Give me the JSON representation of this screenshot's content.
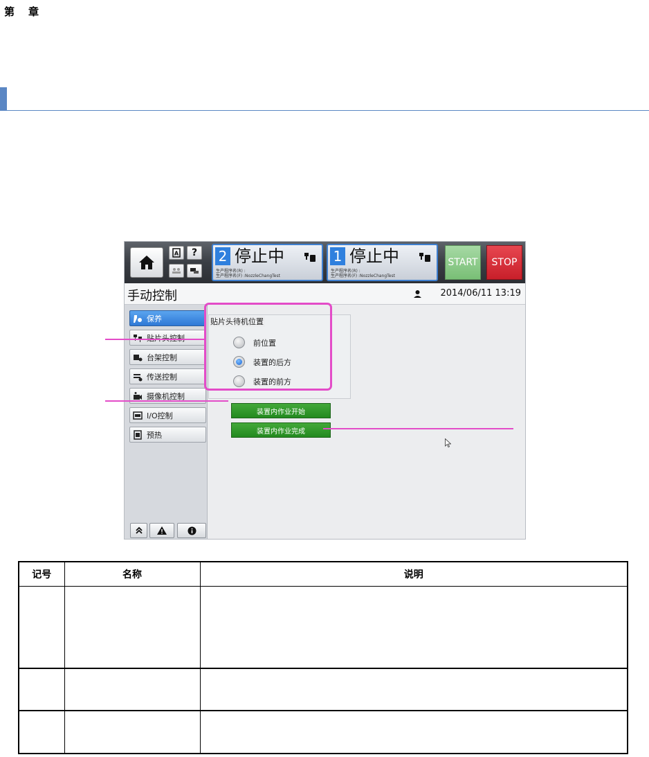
{
  "chapter": {
    "prefix": "第",
    "suffix": "章"
  },
  "screen": {
    "topbar": {
      "lanes": [
        {
          "number": "2",
          "state": "停止中",
          "info_line1": "生产程序名(R) :",
          "info_line2": "生产程序名(F) :NozzleChangTest"
        },
        {
          "number": "1",
          "state": "停止中",
          "info_line1": "生产程序名(R) :",
          "info_line2": "生产程序名(F) :NozzleChangTest"
        }
      ],
      "start_label": "START",
      "stop_label": "STOP",
      "help_label": "?"
    },
    "title": "手动控制",
    "datetime": "2014/06/11 13:19",
    "sidebar": {
      "items": [
        {
          "label": "保养",
          "icon": "maintenance-icon"
        },
        {
          "label": "贴片头控制",
          "icon": "head-icon"
        },
        {
          "label": "台架控制",
          "icon": "gantry-icon"
        },
        {
          "label": "传送控制",
          "icon": "conveyor-icon"
        },
        {
          "label": "摄像机控制",
          "icon": "camera-icon"
        },
        {
          "label": "I/O控制",
          "icon": "io-icon"
        },
        {
          "label": "预热",
          "icon": "preheat-icon"
        }
      ]
    },
    "content": {
      "group_title": "贴片头待机位置",
      "radio_options": [
        "前位置",
        "装置的后方",
        "装置的前方"
      ],
      "selected_index": 1,
      "start_work_label": "装置内作业开始",
      "finish_work_label": "装置内作业完成"
    },
    "colors": {
      "accent_blue": "#2f80de",
      "start_green": "#79bf76",
      "stop_red": "#c81f2a",
      "annotation_pink": "#e34cc8"
    }
  },
  "table": {
    "headers": [
      "记号",
      "名称",
      "说明"
    ],
    "rows": [
      [
        "",
        "",
        ""
      ],
      [
        "",
        "",
        ""
      ],
      [
        "",
        "",
        ""
      ]
    ]
  }
}
